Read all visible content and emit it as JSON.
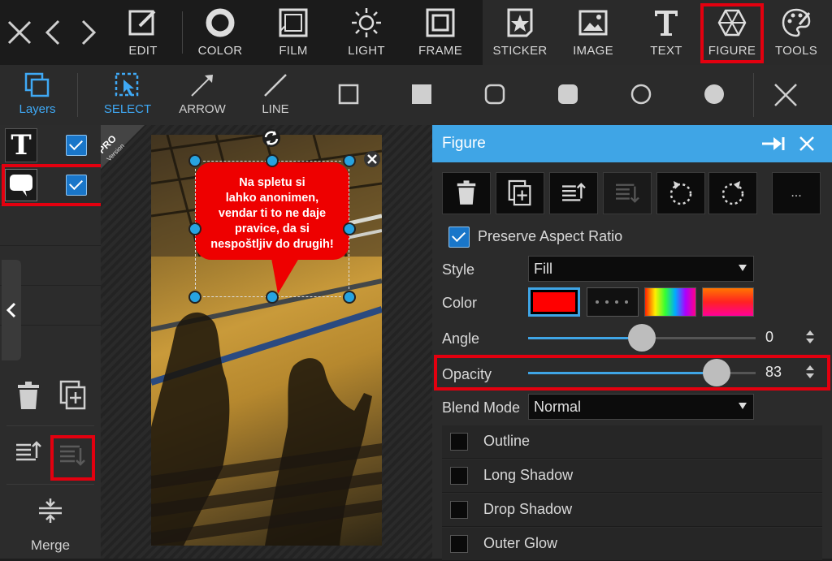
{
  "toolbar": {
    "close": "close-icon",
    "back": "chevron-left-icon",
    "forward": "chevron-right-icon",
    "items": [
      {
        "label": "EDIT",
        "icon": "edit-icon"
      },
      {
        "label": "COLOR",
        "icon": "color-icon"
      },
      {
        "label": "FILM",
        "icon": "film-icon"
      },
      {
        "label": "LIGHT",
        "icon": "light-icon"
      },
      {
        "label": "FRAME",
        "icon": "frame-icon"
      },
      {
        "label": "STICKER",
        "icon": "sticker-icon"
      },
      {
        "label": "IMAGE",
        "icon": "image-icon"
      },
      {
        "label": "TEXT",
        "icon": "text-icon"
      },
      {
        "label": "FIGURE",
        "icon": "figure-icon"
      },
      {
        "label": "TOOLS",
        "icon": "palette-icon"
      }
    ]
  },
  "subtoolbar": {
    "layers": "Layers",
    "select": "SELECT",
    "arrow": "ARROW",
    "line": "LINE",
    "shapes": [
      "square-outline",
      "square-filled",
      "rounded-square-outline",
      "rounded-square-filled",
      "circle-outline",
      "circle-filled"
    ]
  },
  "layers_panel": {
    "rows": [
      {
        "icon": "text-layer-icon",
        "glyph": "T",
        "checked": true
      },
      {
        "icon": "speech-bubble-layer-icon",
        "checked": true
      }
    ],
    "merge": "Merge"
  },
  "canvas": {
    "badge_top": "PRO",
    "badge_bottom": "Version",
    "bubble_text": [
      "Na spletu si",
      "lahko anonimen,",
      "vendar ti to ne daje",
      "pravice, da si",
      "nespoštljiv do drugih!"
    ]
  },
  "figure_panel": {
    "title": "Figure",
    "more": "...",
    "preserve_aspect": "Preserve Aspect Ratio",
    "style_label": "Style",
    "style_value": "Fill",
    "color_label": "Color",
    "angle_label": "Angle",
    "angle_value": "0",
    "angle_fraction": 0.5,
    "opacity_label": "Opacity",
    "opacity_value": "83",
    "opacity_fraction": 0.83,
    "blend_label": "Blend Mode",
    "blend_value": "Normal",
    "effects": [
      "Outline",
      "Long Shadow",
      "Drop Shadow",
      "Outer Glow"
    ]
  },
  "colors": {
    "accent": "#3fa5e6",
    "highlight": "#e3000f",
    "fill_color": "#ff0000"
  }
}
